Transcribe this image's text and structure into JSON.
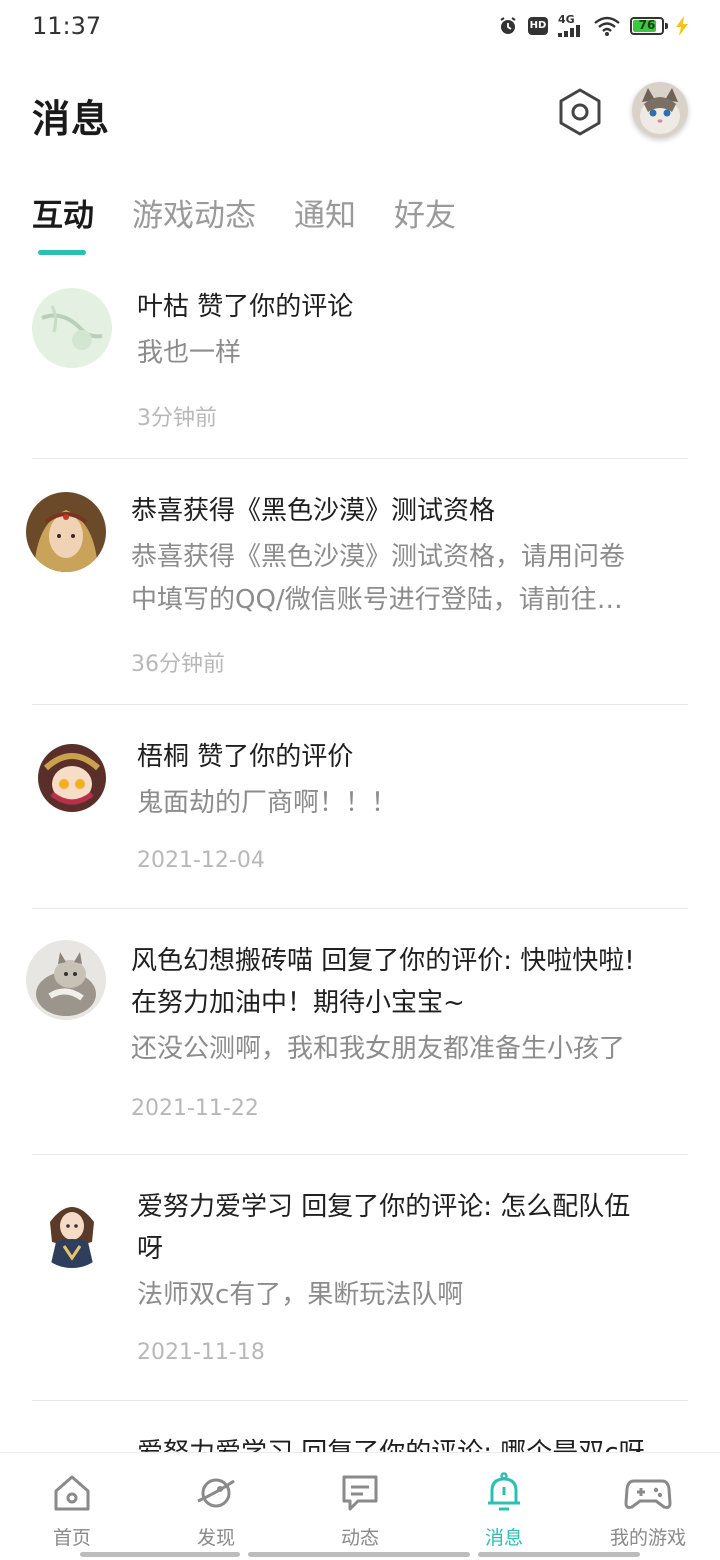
{
  "status_bar": {
    "time": "11:37",
    "hd": "HD",
    "network": "4G",
    "battery": "76",
    "icons": [
      "alarm-icon",
      "hd-icon",
      "signal-icon",
      "wifi-icon",
      "battery-icon",
      "charging-icon"
    ]
  },
  "header": {
    "title": "消息",
    "settings_icon": "settings-hex-icon",
    "avatar": "user-avatar-cat"
  },
  "tabs": [
    {
      "label": "互动",
      "active": true
    },
    {
      "label": "游戏动态",
      "active": false
    },
    {
      "label": "通知",
      "active": false
    },
    {
      "label": "好友",
      "active": false
    }
  ],
  "accent_color": "#2cc0b4",
  "messages": [
    {
      "title": "叶枯 赞了你的评论",
      "body": "我也一样",
      "time": "3分钟前"
    },
    {
      "title": "恭喜获得《黑色沙漠》测试资格",
      "body_line1": "恭喜获得《黑色沙漠》测试资格，请用问卷",
      "body_line2": "中填写的QQ/微信账号进行登陆，请前往…",
      "time": "36分钟前"
    },
    {
      "title": "梧桐 赞了你的评价",
      "body": "鬼面劫的厂商啊！！！",
      "time": "2021-12-04"
    },
    {
      "title_line1": "风色幻想搬砖喵 回复了你的评价: 快啦快啦!",
      "title_line2": "在努力加油中！期待小宝宝~",
      "body": "还没公测啊，我和我女朋友都准备生小孩了",
      "time": "2021-11-22"
    },
    {
      "title_line1": "爱努力爱学习 回复了你的评论: 怎么配队伍",
      "title_line2": "呀",
      "body": "法师双c有了，果断玩法队啊",
      "time": "2021-11-18"
    },
    {
      "title": "爱努力爱学习 回复了你的评论: 哪个是双c呀"
    }
  ],
  "nav": [
    {
      "label": "首页",
      "icon": "home-icon",
      "active": false
    },
    {
      "label": "发现",
      "icon": "planet-icon",
      "active": false
    },
    {
      "label": "动态",
      "icon": "chat-icon",
      "active": false
    },
    {
      "label": "消息",
      "icon": "bell-icon",
      "active": true
    },
    {
      "label": "我的游戏",
      "icon": "gamepad-icon",
      "active": false
    }
  ]
}
